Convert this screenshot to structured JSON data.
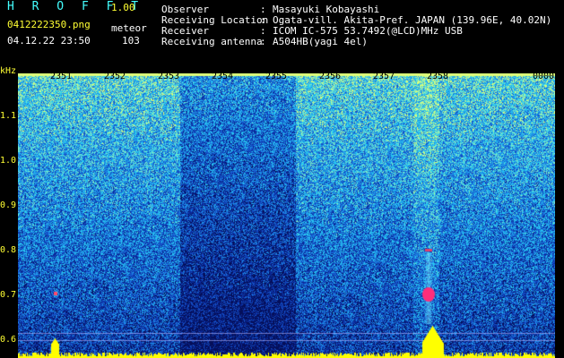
{
  "header": {
    "app_title": "H R O F F T",
    "version": "1.00",
    "filename": "0412222350.png",
    "mode": "meteor",
    "timestamp": "04.12.22 23:50",
    "count": "103"
  },
  "info": [
    {
      "label": "Observer",
      "value": "Masayuki Kobayashi"
    },
    {
      "label": "Receiving Location",
      "value": "Ogata-vill. Akita-Pref. JAPAN (139.96E, 40.02N)"
    },
    {
      "label": "Receiver",
      "value": "ICOM IC-575 53.7492(@LCD)MHz USB"
    },
    {
      "label": "Receiving antenna",
      "value": "A504HB(yagi 4el)"
    }
  ],
  "spectrogram": {
    "y_unit": "kHz",
    "y_ticks": [
      "1.1",
      "1.0",
      "0.9",
      "0.8",
      "0.7",
      "0.6"
    ],
    "x_ticks": [
      "2351",
      "2352",
      "2353",
      "2354",
      "2355",
      "2356",
      "2357",
      "2358",
      "0000"
    ],
    "colors": {
      "background": "#0a1a80",
      "noise_hi": "#22c0ff",
      "event": "#ff2d7a",
      "baseline": "#ffff00"
    }
  }
}
